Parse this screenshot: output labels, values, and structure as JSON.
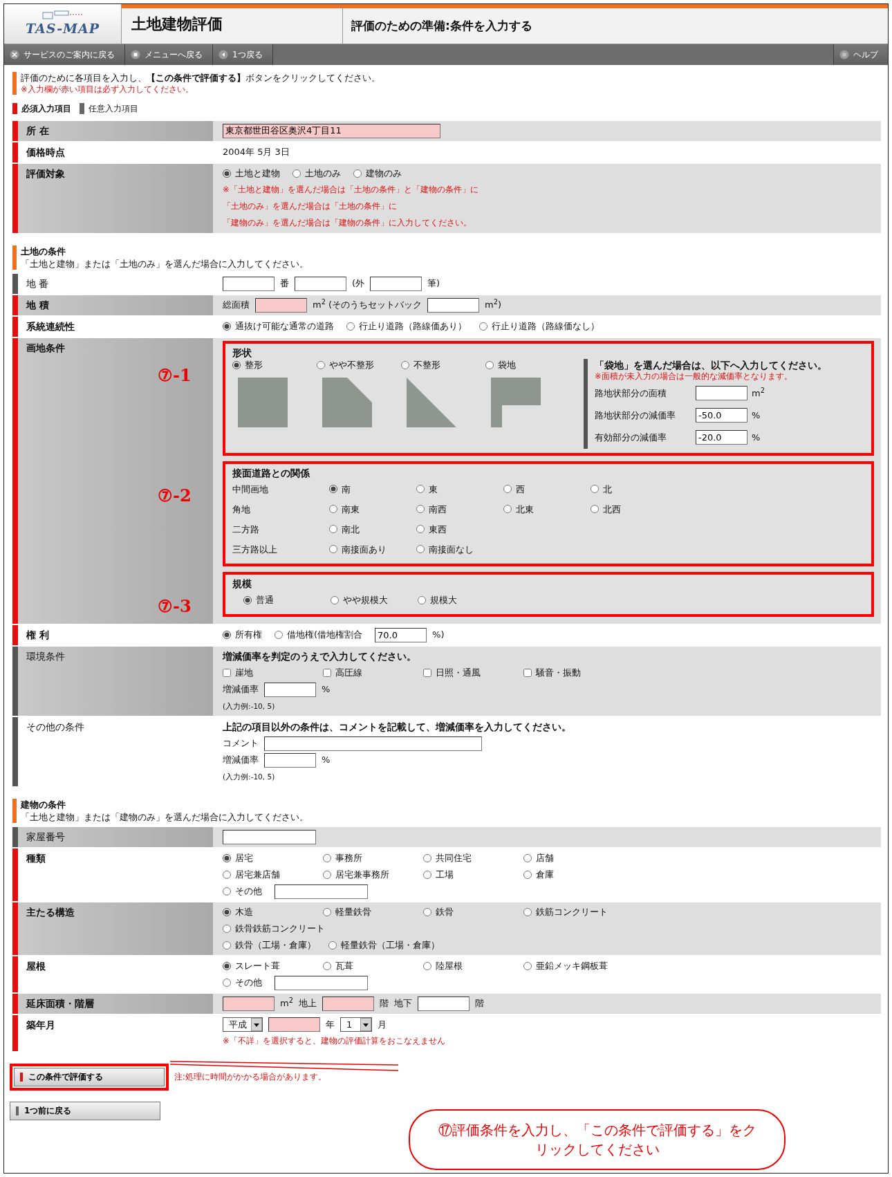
{
  "header": {
    "logo": "TAS-MAP",
    "title": "土地建物評価",
    "subtitle": "評価のための準備:条件を入力する"
  },
  "toolbar": [
    {
      "kind": "close",
      "label": "サービスのご案内に戻る"
    },
    {
      "kind": "menu",
      "label": "メニューへ戻る"
    },
    {
      "kind": "back",
      "label": "1つ戻る"
    }
  ],
  "help": {
    "label": "ヘルプ"
  },
  "intro": {
    "text": "評価のために各項目を入力し、**【この条件で評価する】**ボタンをクリックしてください。",
    "note": "※入力欄が赤い項目は必ず入力してください。"
  },
  "legend": [
    {
      "label": "必須入力項目",
      "required": true
    },
    {
      "label": "任意入力項目",
      "required": false
    }
  ],
  "sections": [
    {
      "rows": [
        {
          "label": "所 在",
          "required": true,
          "lines": [
            {
              "parts": [
                {
                  "kind": "long_input",
                  "value": "東京都世田谷区奥沢4丁目11",
                  "required": true
                }
              ]
            }
          ]
        },
        {
          "label": "価格時点",
          "required": true,
          "lines": [
            {
              "parts": [
                {
                  "kind": "text",
                  "text": "2004年 5月 3日"
                }
              ]
            }
          ]
        },
        {
          "label": "評価対象",
          "required": true,
          "lines": [
            {
              "parts": [
                {
                  "kind": "radio",
                  "label": "土地と建物",
                  "selected": true
                },
                {
                  "kind": "radio",
                  "label": "土地のみ",
                  "selected": false
                },
                {
                  "kind": "radio",
                  "label": "建物のみ",
                  "selected": false
                }
              ]
            },
            {
              "parts": [
                {
                  "kind": "note",
                  "text": "※「土地と建物」を選んだ場合は「土地の条件」と「建物の条件」に"
                }
              ]
            },
            {
              "parts": [
                {
                  "kind": "note",
                  "text": "「土地のみ」を選んだ場合は「土地の条件」に"
                }
              ]
            },
            {
              "parts": [
                {
                  "kind": "note",
                  "text": "「建物のみ」を選んだ場合は「建物の条件」に入力してください。"
                }
              ]
            }
          ]
        }
      ]
    },
    {
      "title": "土地の条件",
      "subtitle": "「土地と建物」または「土地のみ」を選んだ場合に入力してください。",
      "rows": [
        {
          "label": "地 番",
          "required": false,
          "lines": [
            {
              "parts": [
                {
                  "kind": "input",
                  "required": false
                },
                {
                  "kind": "text",
                  "text": "番"
                },
                {
                  "kind": "input",
                  "required": false
                },
                {
                  "kind": "text",
                  "text": "(外"
                },
                {
                  "kind": "input",
                  "required": false
                },
                {
                  "kind": "text",
                  "text": "筆)"
                }
              ]
            }
          ]
        },
        {
          "label": "地 積",
          "required": true,
          "lines": [
            {
              "parts": [
                {
                  "kind": "text",
                  "text": "総面積"
                },
                {
                  "kind": "input",
                  "required": true
                },
                {
                  "kind": "text",
                  "text": "m$^{2}$ (そのうちセットバック"
                },
                {
                  "kind": "input",
                  "required": false
                },
                {
                  "kind": "text",
                  "text": "m$^{2}$)"
                }
              ]
            }
          ]
        },
        {
          "label": "系統連続性",
          "required": true,
          "lines": [
            {
              "parts": [
                {
                  "kind": "radio",
                  "label": "通抜け可能な通常の道路",
                  "selected": true
                },
                {
                  "kind": "radio",
                  "label": "行止り道路（路線価あり）",
                  "selected": false
                },
                {
                  "kind": "radio",
                  "label": "行止り道路（路線価なし）",
                  "selected": false
                }
              ]
            }
          ]
        },
        {
          "label": "画地条件",
          "required": true,
          "kind": "lot",
          "blocks": [
            {
              "marker": "⑦-1",
              "title": "形状",
              "shapes": [
                {
                  "label": "整形",
                  "selected": true,
                  "kind": "square"
                },
                {
                  "label": "やや不整形",
                  "selected": false,
                  "kind": "cut"
                },
                {
                  "label": "不整形",
                  "selected": false,
                  "kind": "triangle"
                },
                {
                  "label": "袋地",
                  "selected": false,
                  "kind": "flag"
                }
              ],
              "panel": {
                "title": "「袋地」を選んだ場合は、以下へ入力してください。",
                "note": "※面積が未入力の場合は一般的な減価率となります。",
                "fields": [
                  {
                    "label": "路地状部分の面積",
                    "unit": "m$^{2}$"
                  },
                  {
                    "label": "路地状部分の減価率",
                    "value": "-50.0",
                    "unit": "%"
                  },
                  {
                    "label": "有効部分の減価率",
                    "value": "-20.0",
                    "unit": "%"
                  }
                ]
              }
            },
            {
              "marker": "⑦-2",
              "title": "接面道路との関係",
              "groups": [
                {
                  "label": "中間画地",
                  "options": [
                    {
                      "label": "南",
                      "selected": true
                    },
                    {
                      "label": "東",
                      "selected": false
                    },
                    {
                      "label": "西",
                      "selected": false
                    },
                    {
                      "label": "北",
                      "selected": false
                    }
                  ]
                },
                {
                  "label": "角地",
                  "options": [
                    {
                      "label": "南東",
                      "selected": false
                    },
                    {
                      "label": "南西",
                      "selected": false
                    },
                    {
                      "label": "北東",
                      "selected": false
                    },
                    {
                      "label": "北西",
                      "selected": false
                    }
                  ]
                },
                {
                  "label": "二方路",
                  "options": [
                    {
                      "label": "南北",
                      "selected": false
                    },
                    {
                      "label": "東西",
                      "selected": false
                    }
                  ]
                },
                {
                  "label": "三方路以上",
                  "options": [
                    {
                      "label": "南接面あり",
                      "selected": false
                    },
                    {
                      "label": "南接面なし",
                      "selected": false
                    }
                  ]
                }
              ]
            },
            {
              "marker": "⑦-3",
              "title": "規模",
              "options": [
                {
                  "label": "普通",
                  "selected": true
                },
                {
                  "label": "やや規模大",
                  "selected": false
                },
                {
                  "label": "規模大",
                  "selected": false
                }
              ]
            }
          ]
        },
        {
          "label": "権 利",
          "required": true,
          "lines": [
            {
              "parts": [
                {
                  "kind": "radio",
                  "label": "所有権",
                  "selected": true
                },
                {
                  "kind": "radio",
                  "label": "借地権(借地権割合",
                  "selected": false
                },
                {
                  "kind": "input",
                  "value": "70.0",
                  "required": false
                },
                {
                  "kind": "text",
                  "text": "%)"
                }
              ]
            }
          ]
        },
        {
          "label": "環境条件",
          "required": false,
          "lines": [
            {
              "parts": [
                {
                  "kind": "heading",
                  "text": "増減価率を判定のうえで入力してください。"
                }
              ]
            },
            {
              "columns": [
                {
                  "kind": "checkbox",
                  "label": "崖地",
                  "checked": false
                },
                {
                  "kind": "checkbox",
                  "label": "高圧線",
                  "checked": false
                },
                {
                  "kind": "checkbox",
                  "label": "日照・通風",
                  "checked": false
                },
                {
                  "kind": "checkbox",
                  "label": "騒音・振動",
                  "checked": false
                }
              ]
            },
            {
              "parts": [
                {
                  "kind": "text",
                  "text": "増減価率"
                },
                {
                  "kind": "input",
                  "required": false
                },
                {
                  "kind": "text",
                  "text": "%"
                }
              ]
            },
            {
              "parts": [
                {
                  "kind": "hint",
                  "text": "(入力例:-10, 5)"
                }
              ]
            }
          ]
        },
        {
          "label": "その他の条件",
          "required": false,
          "lines": [
            {
              "parts": [
                {
                  "kind": "heading",
                  "text": "上記の項目以外の条件は、コメントを記載して、増減価率を入力してください。"
                }
              ]
            },
            {
              "parts": [
                {
                  "kind": "text",
                  "text": "コメント"
                },
                {
                  "kind": "long_input",
                  "required": false
                }
              ]
            },
            {
              "parts": [
                {
                  "kind": "text",
                  "text": "増減価率"
                },
                {
                  "kind": "input",
                  "required": false
                },
                {
                  "kind": "text",
                  "text": "%"
                }
              ]
            },
            {
              "parts": [
                {
                  "kind": "hint",
                  "text": "(入力例:-10, 5)"
                }
              ]
            }
          ]
        }
      ]
    },
    {
      "title": "建物の条件",
      "subtitle": "「土地と建物」または「建物のみ」を選んだ場合に入力してください。",
      "rows": [
        {
          "label": "家屋番号",
          "required": false,
          "lines": [
            {
              "parts": [
                {
                  "kind": "medium_input",
                  "required": false
                }
              ]
            }
          ]
        },
        {
          "label": "種類",
          "required": true,
          "lines": [
            {
              "columns": [
                {
                  "kind": "radio",
                  "label": "居宅",
                  "selected": true
                },
                {
                  "kind": "radio",
                  "label": "事務所",
                  "selected": false
                },
                {
                  "kind": "radio",
                  "label": "共同住宅",
                  "selected": false
                },
                {
                  "kind": "radio",
                  "label": "店舗",
                  "selected": false
                }
              ]
            },
            {
              "columns": [
                {
                  "kind": "radio",
                  "label": "居宅兼店舗",
                  "selected": false
                },
                {
                  "kind": "radio",
                  "label": "居宅兼事務所",
                  "selected": false
                },
                {
                  "kind": "radio",
                  "label": "工場",
                  "selected": false
                },
                {
                  "kind": "radio",
                  "label": "倉庫",
                  "selected": false
                }
              ]
            },
            {
              "parts": [
                {
                  "kind": "radio",
                  "label": "その他",
                  "selected": false
                },
                {
                  "kind": "medium_input",
                  "required": false
                }
              ]
            }
          ]
        },
        {
          "label": "主たる構造",
          "required": true,
          "lines": [
            {
              "columns": [
                {
                  "kind": "radio",
                  "label": "木造",
                  "selected": true
                },
                {
                  "kind": "radio",
                  "label": "軽量鉄骨",
                  "selected": false
                },
                {
                  "kind": "radio",
                  "label": "鉄骨",
                  "selected": false
                },
                {
                  "kind": "radio",
                  "label": "鉄筋コンクリート",
                  "selected": false
                }
              ]
            },
            {
              "parts": [
                {
                  "kind": "radio",
                  "label": "鉄骨鉄筋コンクリート",
                  "selected": false
                }
              ]
            },
            {
              "parts": [
                {
                  "kind": "radio",
                  "label": "鉄骨（工場・倉庫）",
                  "selected": false
                },
                {
                  "kind": "radio",
                  "label": "軽量鉄骨（工場・倉庫）",
                  "selected": false
                }
              ]
            }
          ]
        },
        {
          "label": "屋根",
          "required": true,
          "lines": [
            {
              "columns": [
                {
                  "kind": "radio",
                  "label": "スレート葺",
                  "selected": true
                },
                {
                  "kind": "radio",
                  "label": "瓦葺",
                  "selected": false
                },
                {
                  "kind": "radio",
                  "label": "陸屋根",
                  "selected": false
                },
                {
                  "kind": "radio",
                  "label": "亜鉛メッキ鋼板葺",
                  "selected": false
                }
              ]
            },
            {
              "parts": [
                {
                  "kind": "radio",
                  "label": "その他",
                  "selected": false
                },
                {
                  "kind": "medium_input",
                  "required": false
                }
              ]
            }
          ]
        },
        {
          "label": "延床面積・階層",
          "required": true,
          "lines": [
            {
              "parts": [
                {
                  "kind": "input",
                  "required": true
                },
                {
                  "kind": "text",
                  "text": "m$^{2}$"
                },
                {
                  "kind": "text",
                  "text": "地上"
                },
                {
                  "kind": "input",
                  "required": true
                },
                {
                  "kind": "text",
                  "text": "階"
                },
                {
                  "kind": "text",
                  "text": "地下"
                },
                {
                  "kind": "input",
                  "required": false
                },
                {
                  "kind": "text",
                  "text": "階"
                }
              ]
            }
          ]
        },
        {
          "label": "築年月",
          "required": true,
          "lines": [
            {
              "parts": [
                {
                  "kind": "select",
                  "value": "平成"
                },
                {
                  "kind": "input",
                  "required": true
                },
                {
                  "kind": "text",
                  "text": "年"
                },
                {
                  "kind": "select",
                  "value": "1"
                },
                {
                  "kind": "text",
                  "text": "月"
                }
              ]
            },
            {
              "parts": [
                {
                  "kind": "note",
                  "text": "※「不詳」を選択すると、建物の評価計算をおこなえません"
                }
              ]
            }
          ]
        }
      ]
    }
  ],
  "buttons": [
    {
      "label": "この条件で評価する",
      "highlighted": true,
      "note": "注:処理に時間がかかる場合があります。"
    },
    {
      "label": "1つ前に戻る",
      "highlighted": false
    }
  ],
  "callout": {
    "text": "⑰評価条件を入力し、「この条件で評価する」をクリックしてください"
  }
}
